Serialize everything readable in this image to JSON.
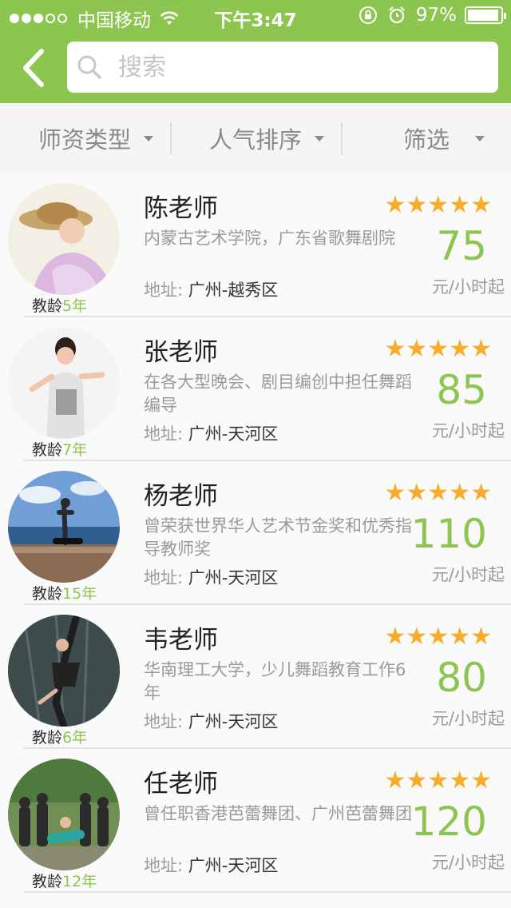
{
  "status_bar": {
    "carrier": "中国移动",
    "time": "下午3:47",
    "battery": "97%"
  },
  "header": {
    "back_icon": "chevron-left-icon",
    "search_icon": "search-icon",
    "search_placeholder": "搜索"
  },
  "filters": [
    {
      "label": "师资类型"
    },
    {
      "label": "人气排序"
    },
    {
      "label": "筛选"
    }
  ],
  "colors": {
    "brand_green": "#8cc54f",
    "star_orange": "#f7ac2c"
  },
  "teachers": [
    {
      "name": "陈老师",
      "desc": "内蒙古艺术学院，广东省歌舞剧院",
      "addr_label": "地址: ",
      "addr": "广州-越秀区",
      "age_label": "教龄",
      "age": "5年",
      "stars": "★★★★★",
      "price": "75",
      "unit": "元/小时起"
    },
    {
      "name": "张老师",
      "desc": "在各大型晚会、剧目编创中担任舞蹈编导",
      "addr_label": "地址: ",
      "addr": "广州-天河区",
      "age_label": "教龄",
      "age": "7年",
      "stars": "★★★★★",
      "price": "85",
      "unit": "元/小时起"
    },
    {
      "name": "杨老师",
      "desc": "曾荣获世界华人艺术节金奖和优秀指导教师奖",
      "addr_label": "地址: ",
      "addr": "广州-天河区",
      "age_label": "教龄",
      "age": "15年",
      "stars": "★★★★★",
      "price": "110",
      "unit": "元/小时起"
    },
    {
      "name": "韦老师",
      "desc": "华南理工大学，少儿舞蹈教育工作6年",
      "addr_label": "地址: ",
      "addr": "广州-天河区",
      "age_label": "教龄",
      "age": "6年",
      "stars": "★★★★★",
      "price": "80",
      "unit": "元/小时起"
    },
    {
      "name": "任老师",
      "desc": "曾任职香港芭蕾舞团、广州芭蕾舞团",
      "addr_label": "地址: ",
      "addr": "广州-天河区",
      "age_label": "教龄",
      "age": "12年",
      "stars": "★★★★★",
      "price": "120",
      "unit": "元/小时起"
    }
  ]
}
